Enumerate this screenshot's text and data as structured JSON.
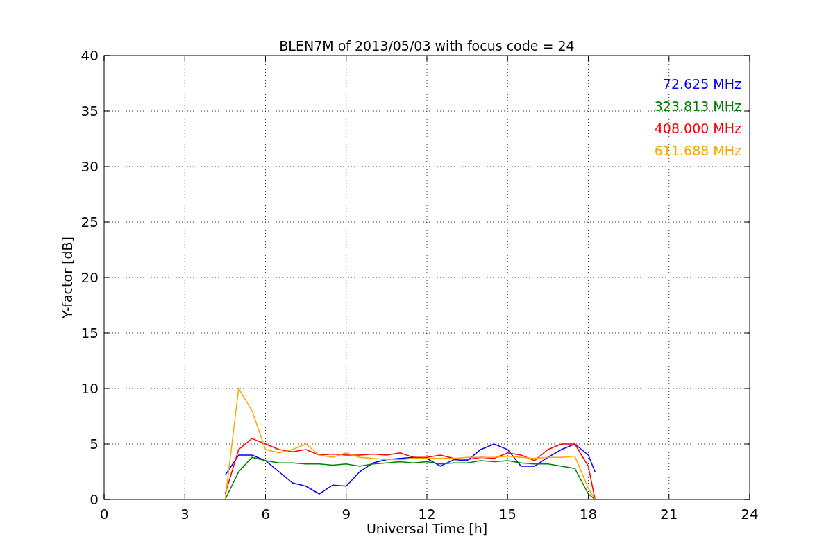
{
  "figure": {
    "chart_data": {
      "type": "line",
      "title": "BLEN7M of 2013/05/03 with focus code = 24",
      "xlabel": "Universal Time [h]",
      "ylabel": "Y-factor [dB]",
      "x": [
        4.5,
        5,
        5.5,
        6,
        6.5,
        7,
        7.5,
        8,
        8.5,
        9,
        9.5,
        10,
        10.5,
        11,
        11.5,
        12,
        12.5,
        13,
        13.5,
        14,
        14.5,
        15,
        15.5,
        16,
        16.5,
        17,
        17.5,
        18,
        18.25
      ],
      "series": [
        {
          "name": "72.625 MHz",
          "color": "#0000ff",
          "values": [
            2.2,
            4,
            4,
            3.5,
            2.5,
            1.5,
            1.2,
            0.5,
            1.3,
            1.2,
            2.5,
            3.3,
            3.6,
            3.7,
            3.8,
            3.7,
            3,
            3.6,
            3.5,
            4.5,
            5,
            4.5,
            3,
            3,
            3.8,
            4.5,
            5,
            4,
            2.5
          ]
        },
        {
          "name": "323.813 MHz",
          "color": "#008000",
          "values": [
            0,
            2.5,
            3.8,
            3.5,
            3.3,
            3.3,
            3.2,
            3.2,
            3.1,
            3.2,
            3,
            3.2,
            3.3,
            3.4,
            3.3,
            3.4,
            3.2,
            3.3,
            3.3,
            3.5,
            3.4,
            3.5,
            3.3,
            3.2,
            3.2,
            3,
            2.8,
            0.5,
            0
          ]
        },
        {
          "name": "408.000 MHz",
          "color": "#ff0000",
          "values": [
            0.5,
            4.5,
            5.5,
            5,
            4.5,
            4.3,
            4.5,
            4,
            4.1,
            4,
            4,
            4.1,
            4,
            4.2,
            3.8,
            3.8,
            4,
            3.7,
            3.6,
            3.8,
            3.7,
            4.2,
            4,
            3.5,
            4.5,
            5,
            5,
            3,
            0
          ]
        },
        {
          "name": "611.688 MHz",
          "color": "#ffa500",
          "values": [
            0,
            10,
            8,
            4.5,
            4.2,
            4.5,
            5,
            4,
            3.8,
            4.2,
            3.8,
            3.7,
            3.6,
            3.6,
            3.7,
            3.7,
            3.7,
            3.7,
            3.8,
            3.8,
            3.8,
            3.9,
            3.8,
            3.7,
            3.8,
            3.8,
            3.9,
            1,
            0
          ]
        }
      ],
      "xlim": [
        0,
        24
      ],
      "ylim": [
        0,
        40
      ],
      "grid": true,
      "xticks": [
        0,
        3,
        6,
        9,
        12,
        15,
        18,
        21,
        24
      ],
      "yticks": [
        0,
        5,
        10,
        15,
        20,
        25,
        30,
        35,
        40
      ]
    }
  }
}
